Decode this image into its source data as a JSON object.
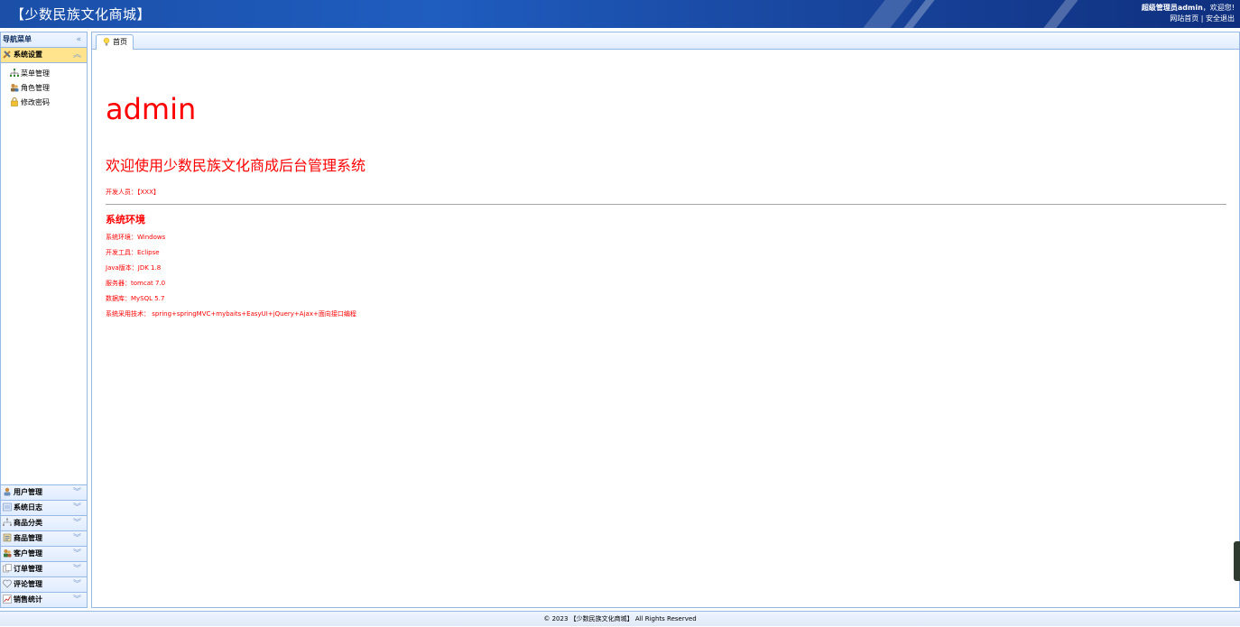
{
  "header": {
    "title": "【少数民族文化商城】",
    "user_prefix": "超级管理员",
    "username": "admin",
    "greeting": "，欢迎您!",
    "site_home": "网站首页",
    "separator": "|",
    "logout": "安全退出"
  },
  "sidebar": {
    "title": "导航菜单",
    "collapse_icon": "«",
    "active_group": {
      "label": "系统设置",
      "items": [
        {
          "label": "菜单管理",
          "icon": "sitemap-icon"
        },
        {
          "label": "角色管理",
          "icon": "role-icon"
        },
        {
          "label": "修改密码",
          "icon": "lock-icon"
        }
      ]
    },
    "groups": [
      {
        "label": "用户管理",
        "icon": "user-icon"
      },
      {
        "label": "系统日志",
        "icon": "log-icon"
      },
      {
        "label": "商品分类",
        "icon": "category-icon"
      },
      {
        "label": "商品管理",
        "icon": "goods-icon"
      },
      {
        "label": "客户管理",
        "icon": "customer-icon"
      },
      {
        "label": "订单管理",
        "icon": "order-icon"
      },
      {
        "label": "评论管理",
        "icon": "comment-icon"
      },
      {
        "label": "销售统计",
        "icon": "stats-icon"
      }
    ]
  },
  "tabs": [
    {
      "label": "首页",
      "icon": "bulb-icon"
    }
  ],
  "content": {
    "big_title": "admin",
    "welcome": "欢迎使用少数民族文化商成后台管理系统",
    "developer": "开发人员：【XXX】",
    "env_title": "系统环境",
    "env_lines": [
      "系统环境：Windows",
      "开发工具：Eclipse",
      "Java版本：JDK 1.8",
      "服务器：tomcat 7.0",
      "数据库：MySQL 5.7",
      "系统采用技术： spring+springMVC+mybaits+EasyUI+jQuery+Ajax+面向接口编程"
    ]
  },
  "footer": {
    "text": "© 2023 【少数民族文化商城】 All Rights Reserved"
  },
  "colors": {
    "accent_text": "#ff0000",
    "header_bg": "#1f5dbf",
    "selected_bg": "#ffe48d",
    "border": "#95b8e7"
  }
}
